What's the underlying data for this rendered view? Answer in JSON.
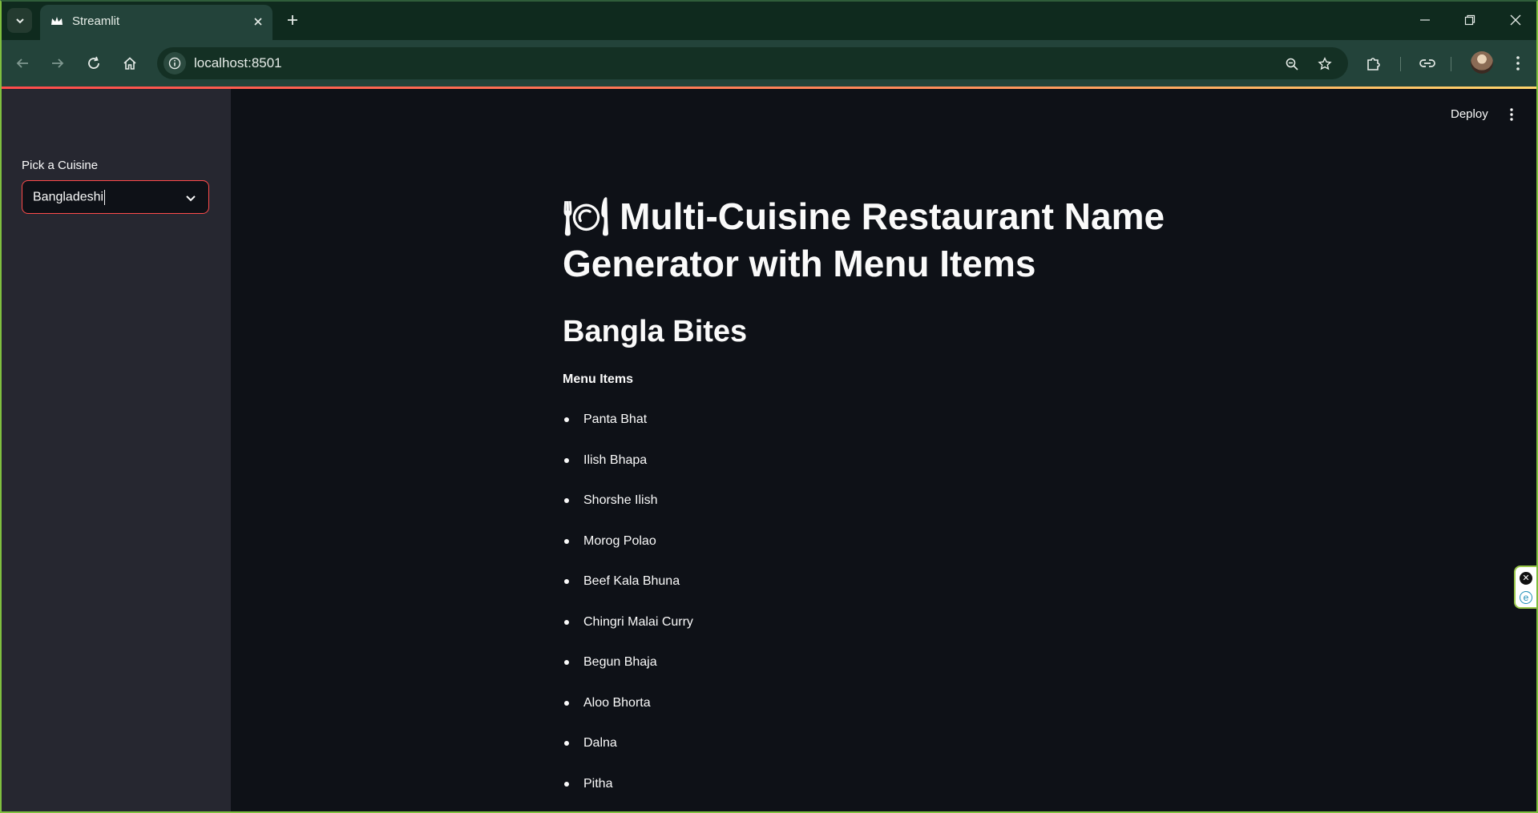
{
  "browser": {
    "tab_title": "Streamlit",
    "url": "localhost:8501"
  },
  "sidebar": {
    "label": "Pick a Cuisine",
    "selected_value": "Bangladeshi"
  },
  "header": {
    "deploy_label": "Deploy"
  },
  "main": {
    "title": "🍽 Multi-Cuisine Restaurant Name Generator with Menu Items",
    "restaurant_name": "Bangla Bites",
    "menu_heading": "Menu Items",
    "menu_items": [
      "Panta Bhat",
      "Ilish Bhapa",
      "Shorshe Ilish",
      "Morog Polao",
      "Beef Kala Bhuna",
      "Chingri Malai Curry",
      "Begun Bhaja",
      "Aloo Bhorta",
      "Dalna",
      "Pitha"
    ]
  },
  "colors": {
    "app_background": "#0e1117",
    "sidebar_background": "#262730",
    "accent": "#ff4b4b",
    "browser_chrome": "#23433a"
  }
}
